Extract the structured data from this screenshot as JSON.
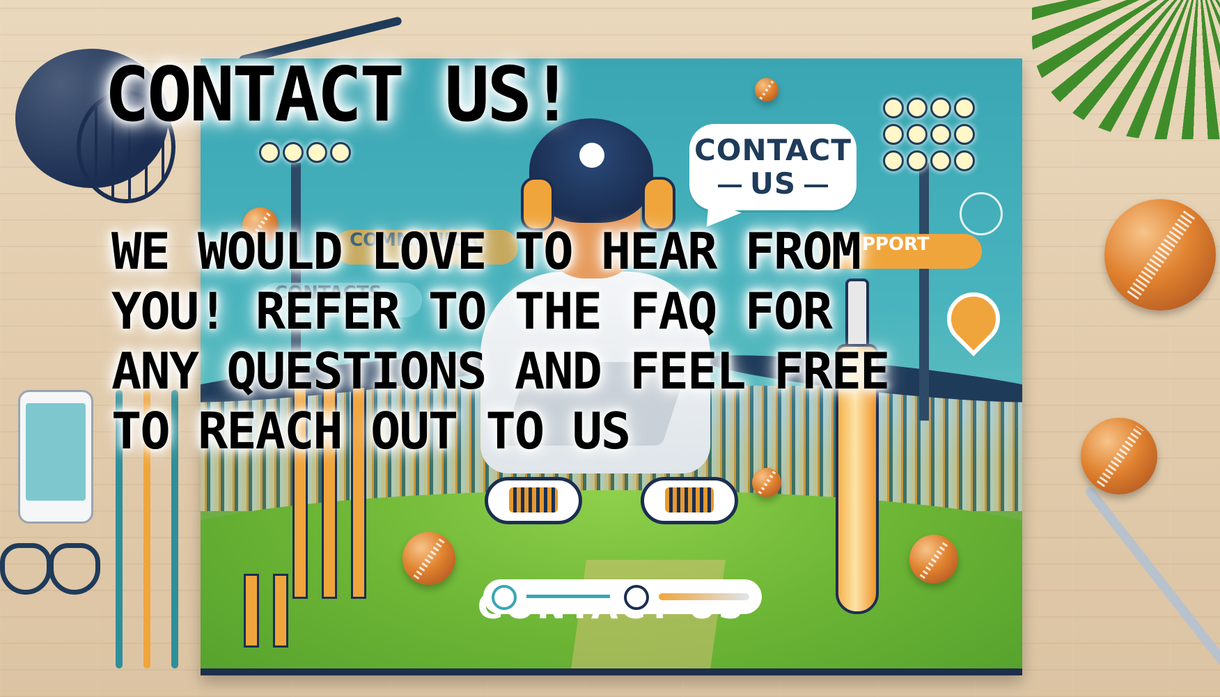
{
  "title": "CONTACT US!",
  "message": "WE WOULD LOVE TO HEAR FROM YOU! REFER TO THE FAQ FOR ANY QUESTIONS AND FEEL FREE TO REACH OUT TO US",
  "poster": {
    "bubble_line1": "CONTACT",
    "bubble_line2": "US",
    "support_pill": "SUPPORT",
    "communication_pill": "COMMUNICA",
    "contact_pill": "CONTACTS",
    "footer_heading": "CONTACT US"
  },
  "colors": {
    "teal": "#3aa6b4",
    "navy": "#1b2e52",
    "orange": "#f0a53c",
    "grass": "#6cb535"
  },
  "icons": [
    "cricket-helmet-icon",
    "location-pin-icon",
    "speech-bubble-icon",
    "cricket-bat-icon",
    "cricket-ball-icon",
    "stumps-icon",
    "phone-icon"
  ]
}
